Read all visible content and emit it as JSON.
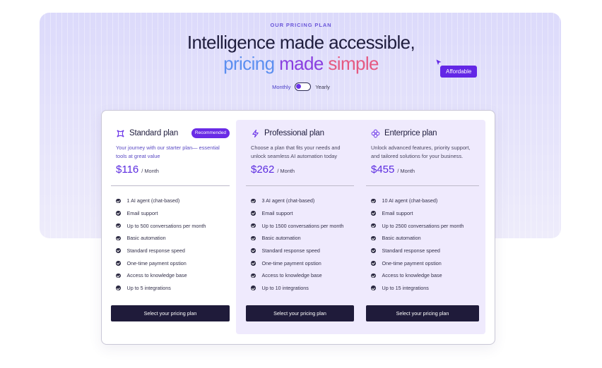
{
  "header": {
    "eyebrow": "OUR PRICING PLAN",
    "headline_line1": "Intelligence made accessible,",
    "headline_word1": "pricing",
    "headline_word2": "made",
    "headline_word3": "simple",
    "toggle": {
      "left_label": "Monthly",
      "right_label": "Yearly",
      "selected": "Monthly"
    },
    "affordable_tag": "Affordable"
  },
  "colors": {
    "accent": "#6327e6",
    "button_dark": "#1f1b3a",
    "price": "#5b2be0",
    "pro_bg": "#efeafd"
  },
  "plans": [
    {
      "name": "Standard plan",
      "icon": "sparkle-icon",
      "badge": "Recommended",
      "description": "Your journey with our starter plan— essential tools at great value",
      "price": "$116",
      "period": "/ Month",
      "features": [
        "1 AI agent (chat-based)",
        "Email support",
        "Up to 500 conversations per month",
        "Basic automation",
        "Standard response speed",
        "One-time payment opstion",
        "Access to knowledge base",
        "Up to 5 integrations"
      ],
      "cta": "Select your pricing plan"
    },
    {
      "name": "Professional plan",
      "icon": "lightning-icon",
      "description": "Choose a plan that fits your needs and unlock seamless AI automation today",
      "price": "$262",
      "period": "/ Month",
      "features": [
        "3 AI agent (chat-based)",
        "Email support",
        "Up to 1500 conversations per month",
        "Basic automation",
        "Standard response speed",
        "One-time payment opstion",
        "Access to knowledge base",
        "Up to 10 integrations"
      ],
      "cta": "Select your pricing plan"
    },
    {
      "name": "Enterprice plan",
      "icon": "flower-icon",
      "description": "Unlock advanced features, priority support, and tailored solutions for your business.",
      "price": "$455",
      "period": "/ Month",
      "features": [
        "10 AI agent (chat-based)",
        "Email support",
        "Up to 2500 conversations per month",
        "Basic automation",
        "Standard response speed",
        "One-time payment opstion",
        "Access to knowledge base",
        "Up to 15 integrations"
      ],
      "cta": "Select your pricing plan"
    }
  ]
}
